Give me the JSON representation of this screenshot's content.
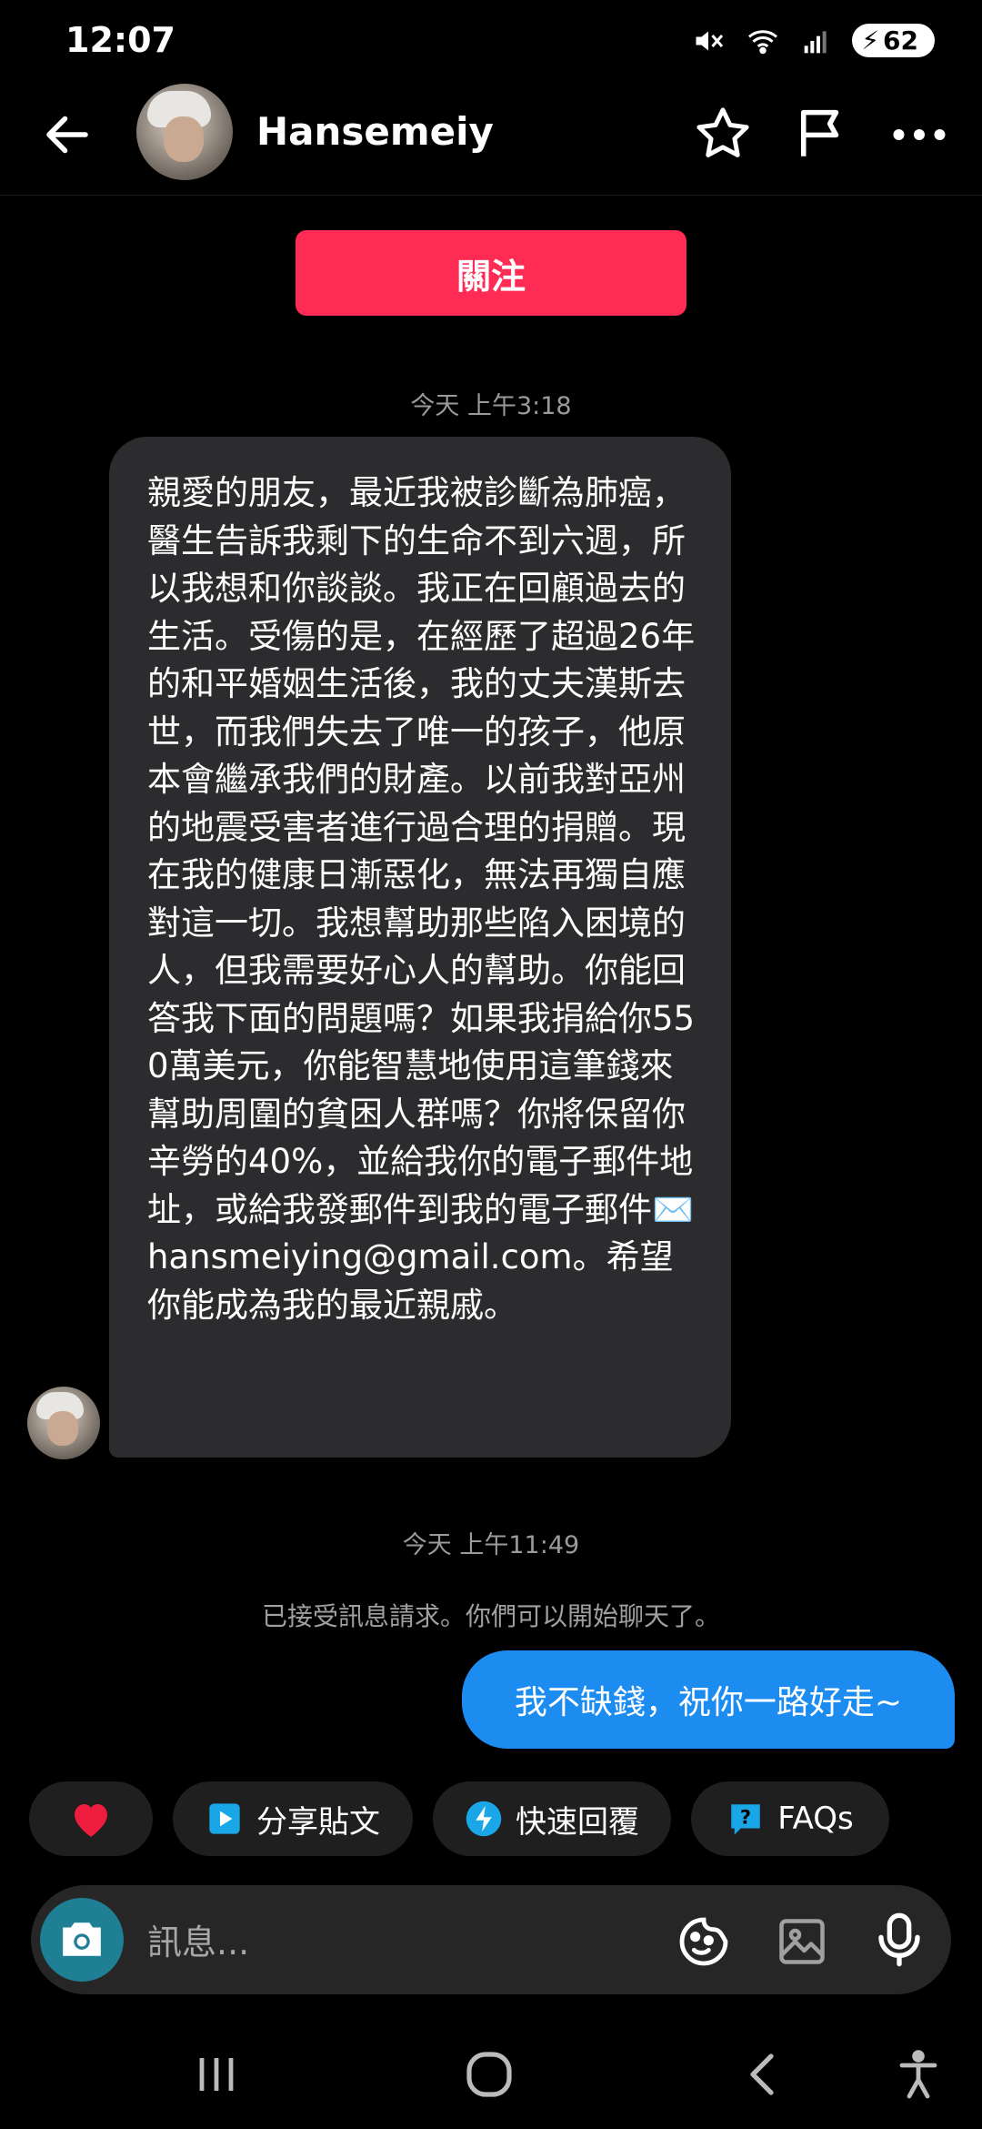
{
  "status_bar": {
    "time": "12:07",
    "battery": "62"
  },
  "header": {
    "username": "Hansemeiy"
  },
  "follow_button": {
    "label": "關注"
  },
  "messages": {
    "timestamp_1": "今天 上午3:18",
    "received_text": "親愛的朋友，最近我被診斷為肺癌，醫生告訴我剩下的生命不到六週，所以我想和你談談。我正在回顧過去的生活。受傷的是，在經歷了超過26年的和平婚姻生活後，我的丈夫漢斯去世，而我們失去了唯一的孩子，他原本會繼承我們的財產。以前我對亞州的地震受害者進行過合理的捐贈。現在我的健康日漸惡化，無法再獨自應對這一切。我想幫助那些陷入困境的人，但我需要好心人的幫助。你能回答我下面的問題嗎？如果我捐給你550萬美元，你能智慧地使用這筆錢來幫助周圍的貧困人群嗎？你將保留你辛勞的40%，並給我你的電子郵件地址，或給我發郵件到我的電子郵件✉️ hansmeiying@gmail.com。希望你能成為我的最近親戚。",
    "timestamp_2": "今天 上午11:49",
    "system_note": "已接受訊息請求。你們可以開始聊天了。",
    "sent_text": "我不缺錢，祝你一路好走~"
  },
  "quick_actions": {
    "share": "分享貼文",
    "quick_reply": "快速回覆",
    "faqs": "FAQs"
  },
  "composer": {
    "placeholder": "訊息..."
  },
  "colors": {
    "follow": "#fe2c55",
    "sent_bubble": "#1d8cf0",
    "received_bubble": "#2c2c2e",
    "camera": "#1e7f95"
  },
  "icons": [
    "back-arrow-icon",
    "star-icon",
    "flag-icon",
    "more-icon",
    "heart-icon",
    "share-play-icon",
    "lightning-icon",
    "question-icon",
    "camera-icon",
    "sticker-icon",
    "gallery-icon",
    "microphone-icon"
  ]
}
